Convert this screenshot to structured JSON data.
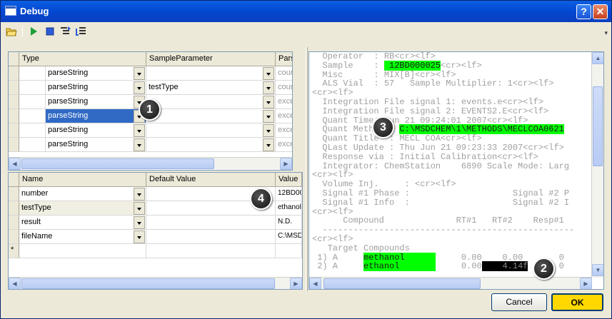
{
  "window": {
    "title": "Debug",
    "help_label": "?",
    "close_label": "✕"
  },
  "toolbar": {
    "overflow_label": "▾"
  },
  "params_grid": {
    "headers": [
      "Type",
      "SampleParameter",
      "Pars"
    ],
    "rows": [
      {
        "type": "parseString",
        "sample": "",
        "pars": "cour"
      },
      {
        "type": "parseString",
        "sample": "testType",
        "pars": "cour"
      },
      {
        "type": "parseString",
        "sample": "",
        "pars": "exce"
      },
      {
        "type": "parseString",
        "sample": "",
        "pars": "exce"
      },
      {
        "type": "parseString",
        "sample": "",
        "pars": "exce"
      },
      {
        "type": "parseString",
        "sample": "",
        "pars": "exce"
      }
    ]
  },
  "vars_grid": {
    "headers": [
      "Name",
      "Default Value",
      "Value"
    ],
    "rows": [
      {
        "name": "number",
        "default": "",
        "value": "12BD00"
      },
      {
        "name": "testType",
        "default": "",
        "value": "ethanol"
      },
      {
        "name": "result",
        "default": "",
        "value": "N.D."
      },
      {
        "name": "fileName",
        "default": "",
        "value": "C:\\MSD"
      }
    ],
    "new_row_marker": "*"
  },
  "log": {
    "lines": [
      {
        "t": "  Operator  : RB<cr><lf>"
      },
      {
        "pre": "  Sample    : ",
        "hl": " 12BD000025",
        "post": "<cr><lf>"
      },
      {
        "t": "  Misc      : MIX[B]<cr><lf>"
      },
      {
        "t": "  ALS Vial  : 57   Sample Multiplier: 1<cr><lf>"
      },
      {
        "t": "<cr><lf>"
      },
      {
        "t": "  Integration File signal 1: events.e<cr><lf>"
      },
      {
        "t": "  Integration File signal 2: EVENTS2.E<cr><lf>"
      },
      {
        "t": "  Quant Time: Jun 21 09:24:01 2007<cr><lf>"
      },
      {
        "pre": "  Quant Method : ",
        "hl": "C:\\MSDCHEM\\1\\METHODS\\MECLCOA0621",
        "post": ""
      },
      {
        "t": "  Quant Title  : MECL COA<cr><lf>"
      },
      {
        "t": "  QLast Update : Thu Jun 21 09:23:33 2007<cr><lf>"
      },
      {
        "t": "  Response via : Initial Calibration<cr><lf>"
      },
      {
        "t": "  Integrator: ChemStation    6890 Scale Mode: Larg"
      },
      {
        "t": "<cr><lf>"
      },
      {
        "t": "  Volume Inj.     : <cr><lf>"
      },
      {
        "t": "  Signal #1 Phase :                    Signal #2 P"
      },
      {
        "t": "  Signal #1 Info  :                    Signal #2 I"
      },
      {
        "t": "<cr><lf>"
      },
      {
        "t": "      Compound              RT#1   RT#2    Resp#1"
      },
      {
        "t": "  -------------------------------------------------"
      },
      {
        "t": "<cr><lf>"
      },
      {
        "t": "   Target Compounds"
      },
      {
        "pre": " 1) A     ",
        "hl": "methanol      ",
        "post": "     0.00    0.00       0"
      },
      {
        "pre": " 2) A     ",
        "hl": "ethanol       ",
        "post": "     0.00",
        "hlb": "    4.14f",
        "post2": "      0"
      }
    ]
  },
  "callouts": [
    "1",
    "2",
    "3",
    "4"
  ],
  "buttons": {
    "cancel": "Cancel",
    "ok": "OK"
  }
}
